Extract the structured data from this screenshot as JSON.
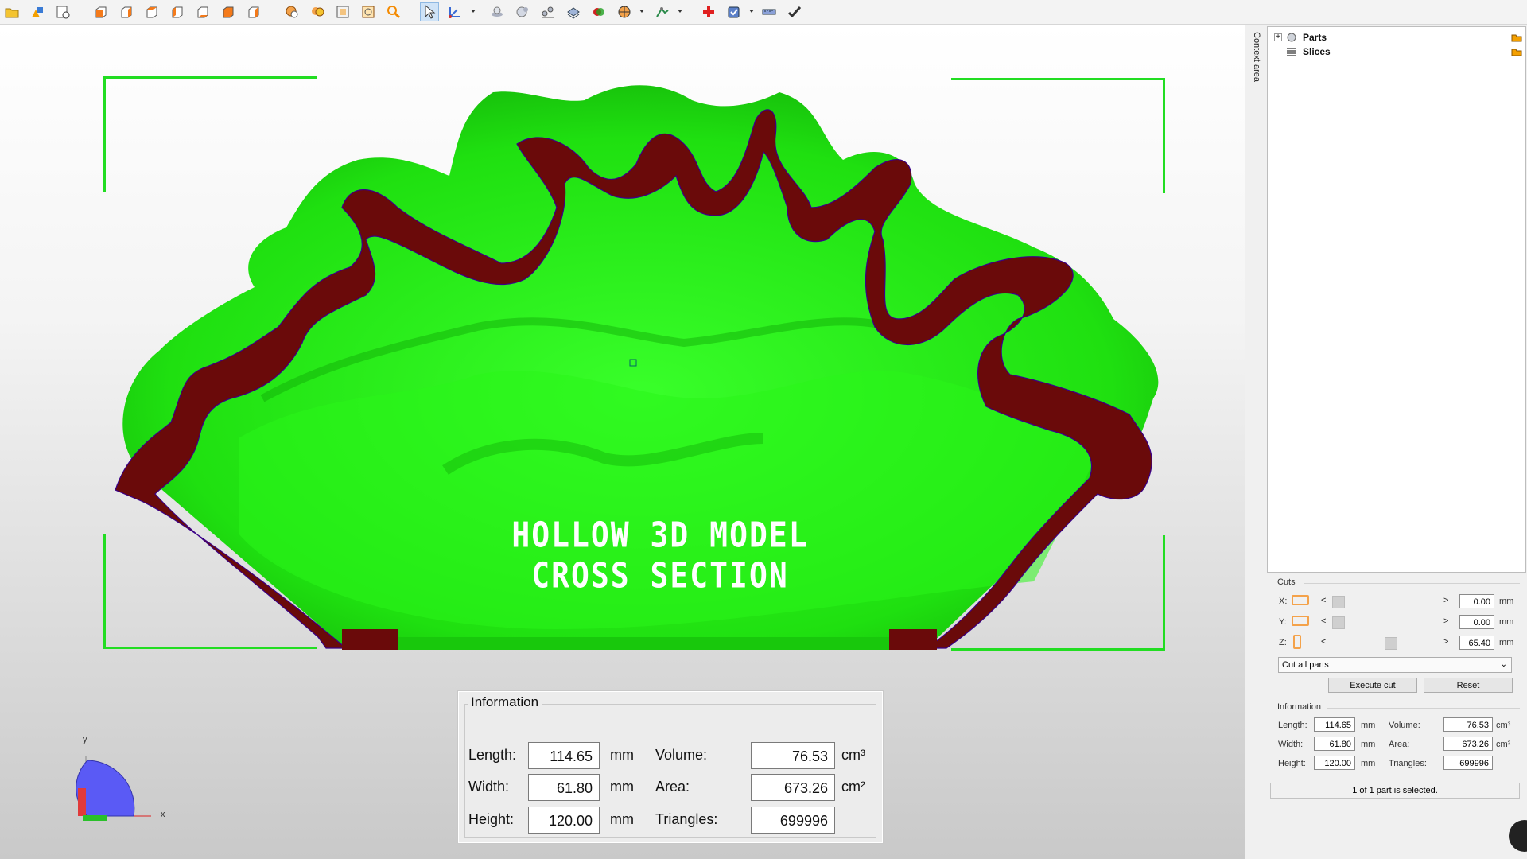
{
  "toolbar": {
    "icons": [
      "open-folder-icon",
      "add-shapes-icon",
      "part-info-icon",
      "view-front-icon",
      "view-back-icon",
      "view-left-icon",
      "view-right-icon",
      "view-top-icon",
      "view-bottom-icon",
      "view-iso-icon",
      "zoom-parts-icon",
      "zoom-all-icon",
      "zoom-frame-icon",
      "zoom-window-icon",
      "zoom-magnifier-icon",
      "select-arrow-icon",
      "move-axis-icon",
      "sphere-icon",
      "sphere-alt-icon",
      "scatter-icon",
      "layers-icon",
      "boolean-icon",
      "section-icon",
      "measure-tool-icon",
      "add-cross-icon",
      "shield-icon",
      "ruler-icon",
      "check-icon"
    ]
  },
  "viewport": {
    "overlay_title": "HOLLOW 3D MODEL CROSS SECTION",
    "axis_labels": {
      "y": "y",
      "x": "x"
    },
    "info": {
      "title": "Information",
      "length_label": "Length:",
      "length_value": "114.65",
      "length_unit": "mm",
      "width_label": "Width:",
      "width_value": "61.80",
      "width_unit": "mm",
      "height_label": "Height:",
      "height_value": "120.00",
      "height_unit": "mm",
      "volume_label": "Volume:",
      "volume_value": "76.53",
      "volume_unit": "cm³",
      "area_label": "Area:",
      "area_value": "673.26",
      "area_unit": "cm²",
      "triangles_label": "Triangles:",
      "triangles_value": "699996"
    },
    "colors": {
      "model_green": "#22ee11",
      "cut_red": "#6a0a0a",
      "frame": "#22dd22"
    }
  },
  "side_tab": "Context area",
  "tree": {
    "items": [
      {
        "label": "Parts",
        "expander": "+"
      },
      {
        "label": "Slices",
        "expander": ""
      }
    ]
  },
  "cuts": {
    "title": "Cuts",
    "x_label": "X:",
    "x_value": "0.00",
    "y_label": "Y:",
    "y_value": "0.00",
    "z_label": "Z:",
    "z_value": "65.40",
    "unit": "mm",
    "left_arrow": "<",
    "right_arrow": ">",
    "mode": "Cut all parts",
    "execute_label": "Execute cut",
    "reset_label": "Reset"
  },
  "panel_info": {
    "title": "Information",
    "length_label": "Length:",
    "length_value": "114.65",
    "width_label": "Width:",
    "width_value": "61.80",
    "height_label": "Height:",
    "height_value": "120.00",
    "mm": "mm",
    "volume_label": "Volume:",
    "volume_value": "76.53",
    "volume_unit": "cm³",
    "area_label": "Area:",
    "area_value": "673.26",
    "area_unit": "cm²",
    "triangles_label": "Triangles:",
    "triangles_value": "699996"
  },
  "status": "1 of 1 part is selected."
}
